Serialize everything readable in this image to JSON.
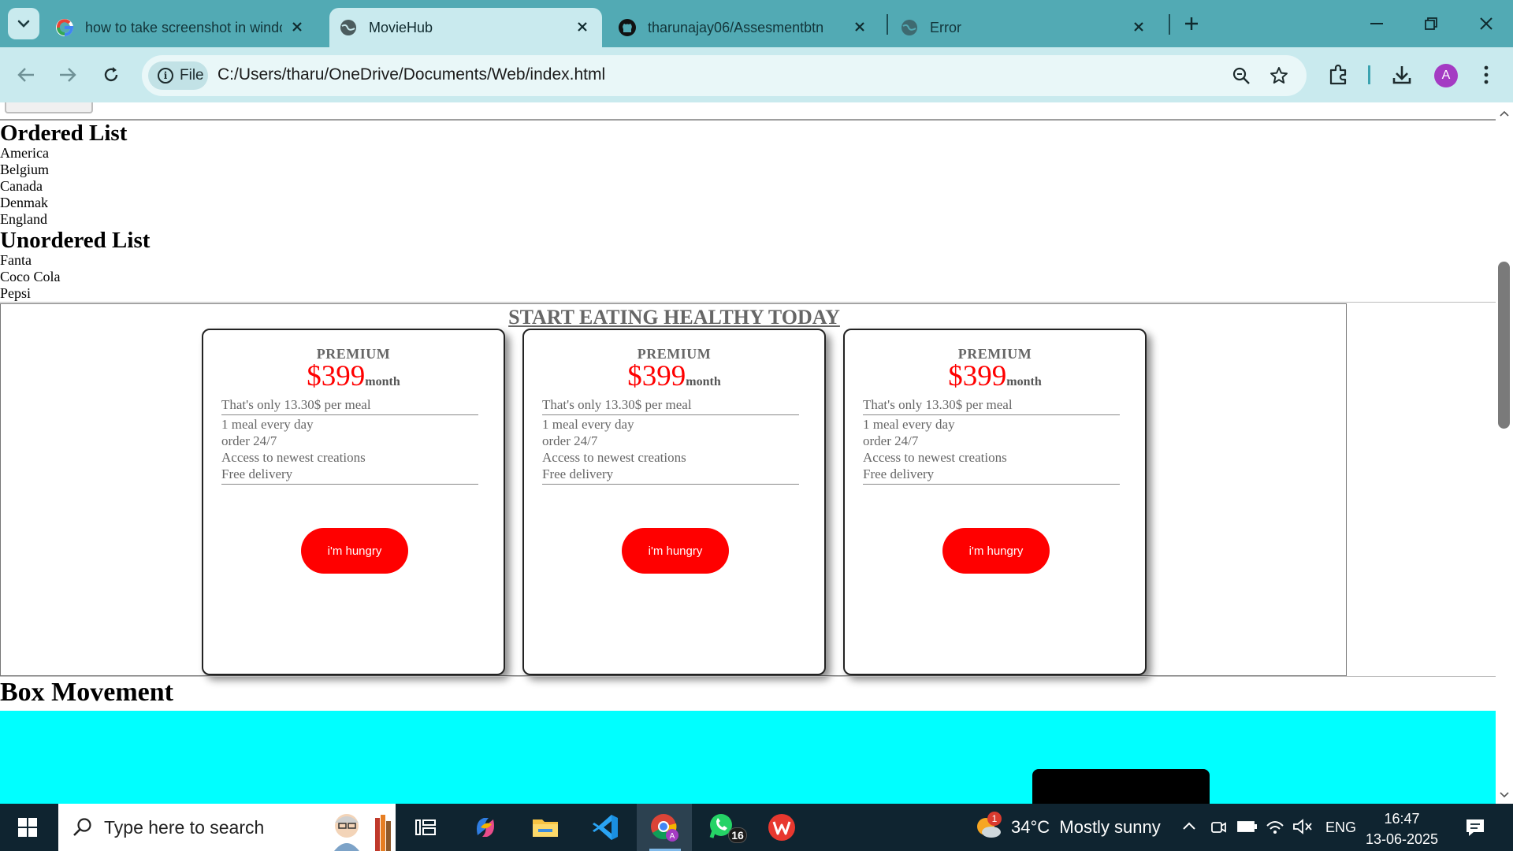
{
  "browser": {
    "tabs": [
      {
        "title": "how to take screenshot in windows",
        "favicon": "google-icon",
        "active": false
      },
      {
        "title": "MovieHub",
        "favicon": "globe-icon",
        "active": true
      },
      {
        "title": "tharunajay06/Assesmentbtn",
        "favicon": "github-icon",
        "active": false
      },
      {
        "title": "Error",
        "favicon": "globe-icon",
        "active": false
      }
    ],
    "chip_label": "File",
    "url": "C:/Users/tharu/OneDrive/Documents/Web/index.html",
    "avatar_letter": "A"
  },
  "page": {
    "ordered_heading": "Ordered List",
    "ordered_items": [
      "America",
      "Belgium",
      "Canada",
      "Denmak",
      "England"
    ],
    "unordered_heading": "Unordered List",
    "unordered_items": [
      "Fanta",
      "Coco Cola",
      "Pepsi"
    ],
    "pricing_title": "START EATING HEALTHY TODAY",
    "cards": [
      {
        "plan": "PREMIUM",
        "price": "$399",
        "period": "month",
        "per_meal": "That's only 13.30$ per meal",
        "features": [
          "1 meal every day",
          "order 24/7",
          "Access to newest creations",
          "Free delivery"
        ],
        "cta": "i'm hungry"
      },
      {
        "plan": "PREMIUM",
        "price": "$399",
        "period": "month",
        "per_meal": "That's only 13.30$ per meal",
        "features": [
          "1 meal every day",
          "order 24/7",
          "Access to newest creations",
          "Free delivery"
        ],
        "cta": "i'm hungry"
      },
      {
        "plan": "PREMIUM",
        "price": "$399",
        "period": "month",
        "per_meal": "That's only 13.30$ per meal",
        "features": [
          "1 meal every day",
          "order 24/7",
          "Access to newest creations",
          "Free delivery"
        ],
        "cta": "i'm hungry"
      }
    ],
    "box_heading": "Box Movement"
  },
  "taskbar": {
    "search_placeholder": "Type here to search",
    "whatsapp_badge": "16",
    "weather_badge": "1",
    "weather": "34°C  Mostly sunny",
    "language": "ENG",
    "time": "16:47",
    "date": "13-06-2025"
  },
  "colors": {
    "tabbar": "#52aab4",
    "toolbar": "#c9eaee",
    "price_red": "#ff0000",
    "box_cyan": "#00ffff",
    "taskbar": "#0f2430"
  }
}
